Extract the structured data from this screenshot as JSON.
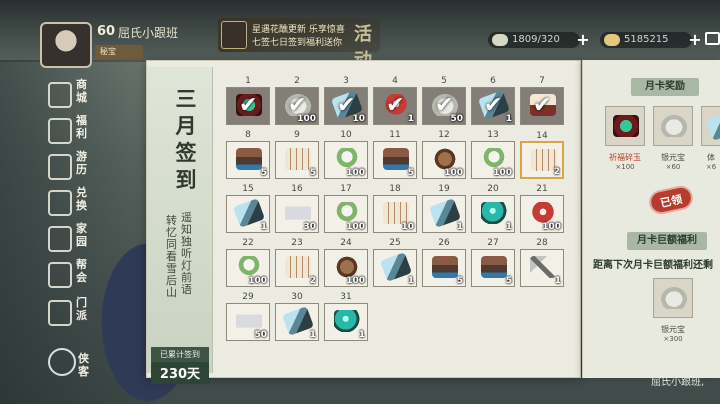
{
  "player": {
    "level": "60",
    "name": "屈氏小跟班",
    "badge": "秘宝"
  },
  "event_banner": {
    "line1": "星遇花醮更新 乐享惊喜",
    "line2": "七签七日签到福利送你",
    "seal": "活动"
  },
  "resources": [
    {
      "name": "silver-coin",
      "value": "1809/320"
    },
    {
      "name": "gold-ingot",
      "value": "5185215"
    }
  ],
  "menu": [
    {
      "label": "商城",
      "icon": "shop-icon"
    },
    {
      "label": "福利",
      "icon": "gift-icon"
    },
    {
      "label": "游历",
      "icon": "travel-icon"
    },
    {
      "label": "兑换",
      "icon": "exchange-icon"
    },
    {
      "label": "家园",
      "icon": "home-icon"
    },
    {
      "label": "帮会",
      "icon": "guild-icon"
    },
    {
      "label": "门派",
      "icon": "sect-icon"
    },
    {
      "label": "侠客",
      "icon": "hero-icon"
    }
  ],
  "signin": {
    "title": "三月签到",
    "poem_right": "遥知独听灯前语",
    "poem_left": "转忆同看雪后山",
    "total_label": "已累计签到",
    "total_days": "230天",
    "days": [
      {
        "day": "1",
        "item": "emerald",
        "count": "",
        "signed": true
      },
      {
        "day": "2",
        "item": "silver",
        "count": "100",
        "signed": true
      },
      {
        "day": "3",
        "item": "jade",
        "count": "10",
        "signed": true
      },
      {
        "day": "4",
        "item": "redbox",
        "count": "1",
        "signed": true
      },
      {
        "day": "5",
        "item": "silver",
        "count": "50",
        "signed": true
      },
      {
        "day": "6",
        "item": "jade",
        "count": "1",
        "signed": true
      },
      {
        "day": "7",
        "item": "book",
        "count": "",
        "signed": true
      },
      {
        "day": "8",
        "item": "chest",
        "count": "5",
        "signed": false
      },
      {
        "day": "9",
        "item": "scroll",
        "count": "5",
        "signed": false
      },
      {
        "day": "10",
        "item": "lotus",
        "count": "100",
        "signed": false
      },
      {
        "day": "11",
        "item": "chest",
        "count": "5",
        "signed": false
      },
      {
        "day": "12",
        "item": "tea",
        "count": "100",
        "signed": false
      },
      {
        "day": "13",
        "item": "lotus",
        "count": "100",
        "signed": false
      },
      {
        "day": "14",
        "item": "scroll",
        "count": "2",
        "signed": false,
        "today": true
      },
      {
        "day": "15",
        "item": "jade",
        "count": "1",
        "signed": false
      },
      {
        "day": "16",
        "item": "cup",
        "count": "30",
        "signed": false
      },
      {
        "day": "17",
        "item": "lotus",
        "count": "100",
        "signed": false
      },
      {
        "day": "18",
        "item": "scroll",
        "count": "10",
        "signed": false
      },
      {
        "day": "19",
        "item": "jade",
        "count": "1",
        "signed": false
      },
      {
        "day": "20",
        "item": "orb",
        "count": "1",
        "signed": false
      },
      {
        "day": "21",
        "item": "redbox",
        "count": "100",
        "signed": false
      },
      {
        "day": "22",
        "item": "lotus",
        "count": "100",
        "signed": false
      },
      {
        "day": "23",
        "item": "scroll",
        "count": "2",
        "signed": false
      },
      {
        "day": "24",
        "item": "tea",
        "count": "100",
        "signed": false
      },
      {
        "day": "25",
        "item": "jade",
        "count": "1",
        "signed": false
      },
      {
        "day": "26",
        "item": "chest",
        "count": "5",
        "signed": false
      },
      {
        "day": "27",
        "item": "chest",
        "count": "5",
        "signed": false
      },
      {
        "day": "28",
        "item": "axe",
        "count": "1",
        "signed": false
      },
      {
        "day": "29",
        "item": "cup",
        "count": "50",
        "signed": false
      },
      {
        "day": "30",
        "item": "jade",
        "count": "1",
        "signed": false
      },
      {
        "day": "31",
        "item": "orb",
        "count": "1",
        "signed": false
      }
    ]
  },
  "monthly_card": {
    "title": "月卡奖励",
    "rewards": [
      {
        "name": "祈福碎玉",
        "count": "×100",
        "item": "emerald"
      },
      {
        "name": "银元宝",
        "count": "×60",
        "item": "silver"
      },
      {
        "name": "体",
        "count": "×6",
        "item": "jade"
      }
    ],
    "claimed": "已领",
    "big_title": "月卡巨额福利",
    "note": "距离下次月卡巨额福利还剩",
    "big_reward": {
      "name": "银元宝",
      "count": "×300",
      "item": "silver"
    }
  },
  "bottom_name": "屈氏小跟班,",
  "colors": {
    "panel": "#ecebe1",
    "accent": "#d9a441",
    "signed_cell": "#837f78",
    "side": "#dfe5d7"
  }
}
